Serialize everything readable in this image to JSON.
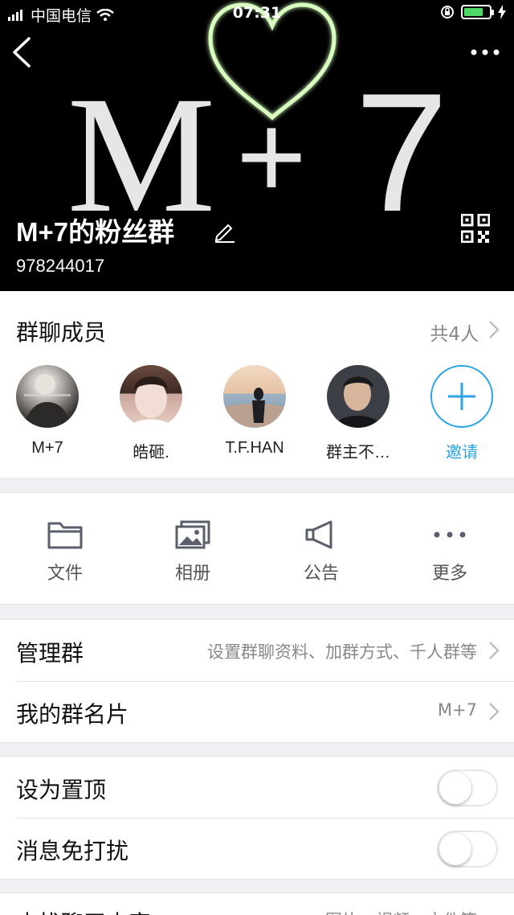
{
  "status_bar": {
    "carrier": "中国电信",
    "time": "07:31",
    "battery_level": 0.8,
    "battery_color": "#4cd964"
  },
  "header": {
    "banner_text_left": "M",
    "banner_text_plus": "+",
    "banner_text_right": "7",
    "group_name": "M+7的粉丝群",
    "group_id": "978244017",
    "icons": [
      "back-icon",
      "more-icon",
      "edit-icon",
      "qr-code-icon"
    ]
  },
  "members": {
    "title": "群聊成员",
    "count_text": "共4人",
    "list": [
      {
        "name": "M+7"
      },
      {
        "name": "皓砸."
      },
      {
        "name": "T.F.HAN"
      },
      {
        "name": "群主不…"
      }
    ],
    "invite_label": "邀请",
    "accent_color": "#2aa3e8"
  },
  "actions": [
    {
      "label": "文件",
      "icon": "folder-icon"
    },
    {
      "label": "相册",
      "icon": "album-icon"
    },
    {
      "label": "公告",
      "icon": "megaphone-icon"
    },
    {
      "label": "更多",
      "icon": "more-dots-icon"
    }
  ],
  "settings": {
    "manage_group": {
      "label": "管理群",
      "value": "设置群聊资料、加群方式、千人群等"
    },
    "my_card": {
      "label": "我的群名片",
      "value": "M+7"
    },
    "pin_top": {
      "label": "设为置顶",
      "on": false
    },
    "mute": {
      "label": "消息免打扰",
      "on": false
    },
    "search_history": {
      "label": "查找聊天内容",
      "value": "图片、视频、文件等"
    }
  }
}
